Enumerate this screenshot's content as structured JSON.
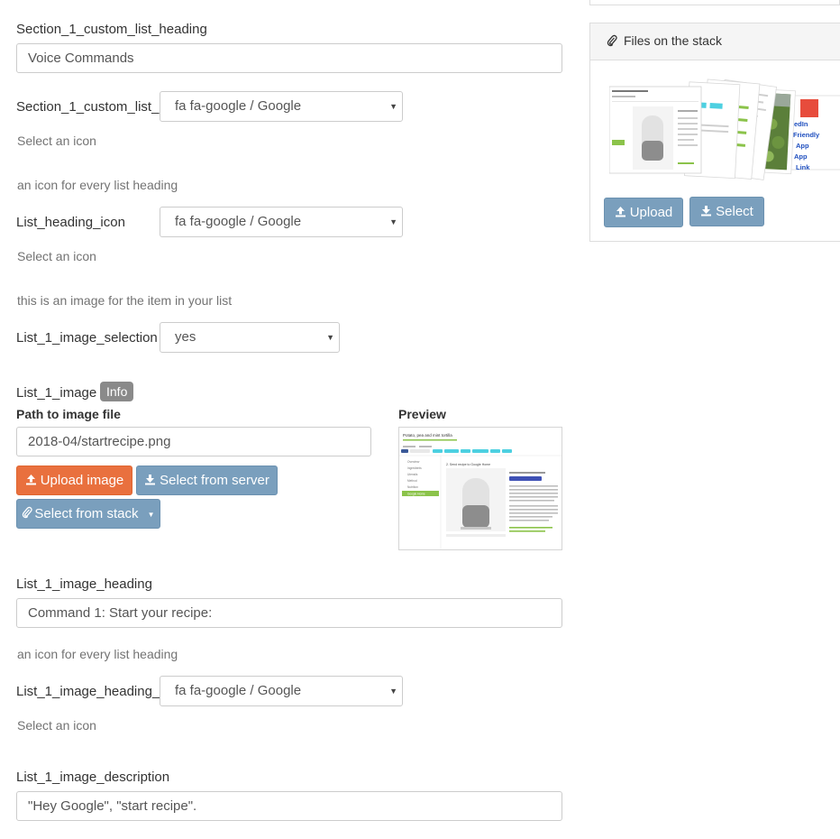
{
  "form": {
    "section1_heading": {
      "label": "Section_1_custom_list_heading",
      "value": "Voice Commands"
    },
    "section1_icon": {
      "label": "Section_1_custom_list_",
      "value": "fa fa-google / Google",
      "help": "Select an icon"
    },
    "list_heading_icon": {
      "desc": "an icon for every list heading",
      "label": "List_heading_icon",
      "value": "fa fa-google / Google",
      "help": "Select an icon"
    },
    "list1_image_selection": {
      "desc": "this is an image for the item in your list",
      "label": "List_1_image_selection",
      "value": "yes"
    },
    "list1_image": {
      "label": "List_1_image",
      "badge": "Info",
      "path_label": "Path to image file",
      "path_value": "2018-04/startrecipe.png",
      "preview_label": "Preview",
      "upload_button": "Upload image",
      "select_server_button": "Select from server",
      "select_stack_button": "Select from stack"
    },
    "list1_image_heading": {
      "label": "List_1_image_heading",
      "value": "Command 1: Start your recipe:"
    },
    "list1_image_heading_icon": {
      "desc": "an icon for every list heading",
      "label": "List_1_image_heading_",
      "value": "fa fa-google / Google",
      "help": "Select an icon"
    },
    "list1_image_description": {
      "label": "List_1_image_description",
      "value": "\"Hey Google\", \"start recipe\"."
    }
  },
  "stack_panel": {
    "title": "Files on the stack",
    "upload_button": "Upload",
    "select_button": "Select",
    "card_words": [
      "edIn",
      "Friendly",
      "App",
      "App",
      "Link"
    ]
  },
  "preview_thumb": {
    "title": "Potato, pea and mint tortilla",
    "heading": "2. Send recipe to Google Home",
    "nav": [
      "Overview",
      "Ingredients",
      "Utensils",
      "Method",
      "Nutrition",
      "Google Home"
    ]
  },
  "colors": {
    "orange": "#e9703e",
    "steel": "#7a9fbd",
    "badge": "#8a8a8a"
  },
  "icons": {
    "upload": "upload-icon",
    "download": "download-icon",
    "paperclip": "paperclip-icon",
    "caret": "caret-down-icon"
  }
}
